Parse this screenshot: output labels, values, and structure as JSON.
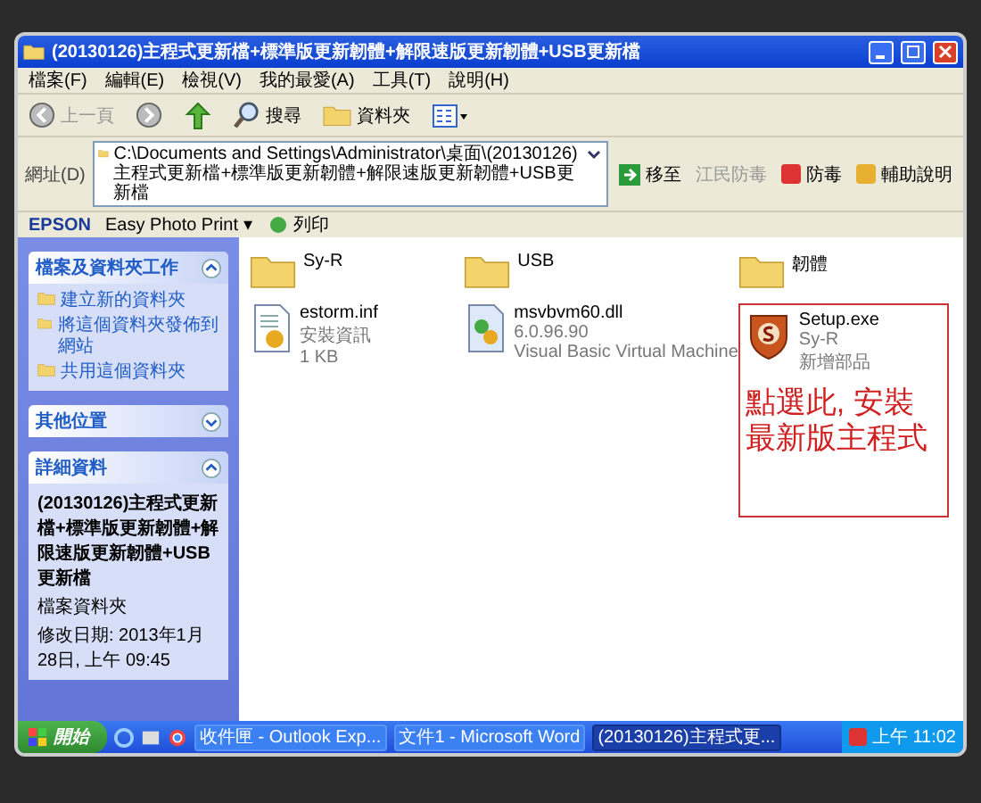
{
  "window": {
    "title": "(20130126)主程式更新檔+標準版更新韌體+解限速版更新韌體+USB更新檔"
  },
  "menu": [
    "檔案(F)",
    "編輯(E)",
    "檢視(V)",
    "我的最愛(A)",
    "工具(T)",
    "說明(H)"
  ],
  "toolbar": {
    "back": "上一頁",
    "search": "搜尋",
    "folders": "資料夾"
  },
  "address": {
    "label": "網址(D)",
    "path": "C:\\Documents and Settings\\Administrator\\桌面\\(20130126)主程式更新檔+標準版更新韌體+解限速版更新韌體+USB更新檔",
    "go": "移至",
    "links": [
      "江民防毒",
      "防毒",
      "輔助說明"
    ]
  },
  "epson": {
    "brand": "EPSON",
    "menu": "Easy Photo Print ▾",
    "print": "列印"
  },
  "panels": [
    {
      "kind": "links",
      "title": "檔案及資料夾工作",
      "expanded": true,
      "items": [
        "建立新的資料夾",
        "將這個資料夾發佈到網站",
        "共用這個資料夾"
      ]
    },
    {
      "kind": "empty",
      "title": "其他位置",
      "expanded": false
    },
    {
      "kind": "details",
      "title": "詳細資料",
      "expanded": true,
      "name": "(20130126)主程式更新檔+標準版更新韌體+解限速版更新韌體+USB更新檔",
      "type": "檔案資料夾",
      "modified": "修改日期: 2013年1月28日, 上午 09:45"
    }
  ],
  "files": [
    {
      "kind": "folder",
      "name": "Sy-R"
    },
    {
      "kind": "folder",
      "name": "USB"
    },
    {
      "kind": "folder",
      "name": "韌體"
    },
    {
      "kind": "inf",
      "name": "estorm.inf",
      "lines": [
        "安裝資訊",
        "1 KB"
      ]
    },
    {
      "kind": "dll",
      "name": "msvbvm60.dll",
      "lines": [
        "6.0.96.90",
        "Visual Basic Virtual Machine"
      ]
    },
    {
      "kind": "exe",
      "name": "Setup.exe",
      "lines": [
        "Sy-R",
        "新增部品"
      ]
    }
  ],
  "callout": "點選此, 安裝最新版主程式",
  "taskbar": {
    "start": "開始",
    "tasks": [
      {
        "label": "收件匣 - Outlook Exp...",
        "selected": false
      },
      {
        "label": "文件1 - Microsoft Word",
        "selected": false
      },
      {
        "label": "(20130126)主程式更...",
        "selected": true
      }
    ],
    "clock": "上午 11:02"
  }
}
